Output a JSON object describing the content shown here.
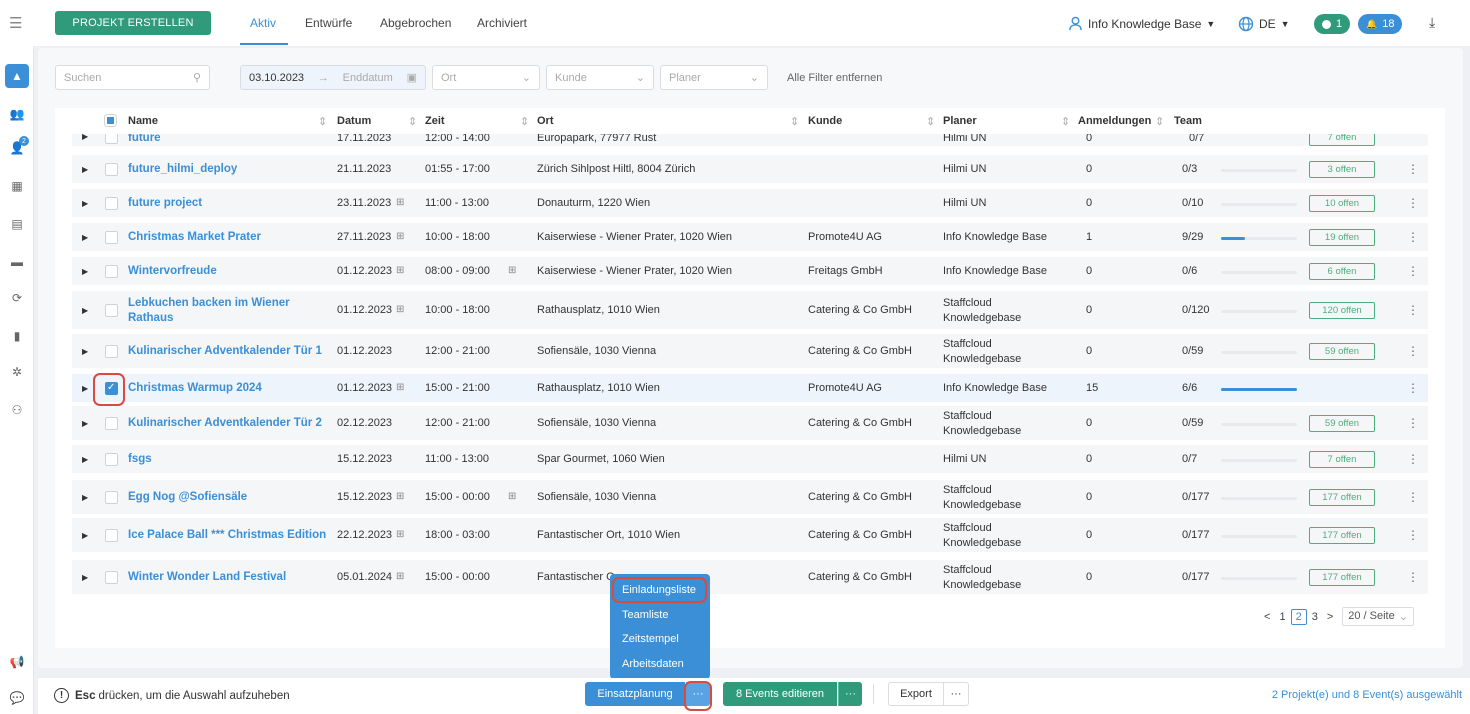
{
  "colors": {
    "accent": "#3a8fd6",
    "green": "#2f9b7a",
    "highlight": "#d94a3f"
  },
  "topbar": {
    "create_button": "PROJEKT ERSTELLEN",
    "tabs": [
      {
        "label": "Aktiv"
      },
      {
        "label": "Entwürfe"
      },
      {
        "label": "Abgebrochen"
      },
      {
        "label": "Archiviert"
      }
    ],
    "user": "Info Knowledge Base",
    "language": "DE",
    "chat_count": "1",
    "notification_count": "18"
  },
  "filters": {
    "search_placeholder": "Suchen",
    "start_date": "03.10.2023",
    "end_date_placeholder": "Enddatum",
    "location_placeholder": "Ort",
    "customer_placeholder": "Kunde",
    "planner_placeholder": "Planer",
    "clear_filters": "Alle Filter entfernen"
  },
  "table": {
    "headers": {
      "name": "Name",
      "date": "Datum",
      "time": "Zeit",
      "location": "Ort",
      "customer": "Kunde",
      "planner": "Planer",
      "registrations": "Anmeldungen",
      "team": "Team"
    },
    "partial_row": {
      "name": "future",
      "date": "17.11.2023",
      "time": "12:00 - 14:00",
      "location": "Europapark, 77977 Rust",
      "planner": "Hilmi UN",
      "registrations": "0",
      "team": "0/7",
      "open": "7 offen"
    },
    "rows": [
      {
        "name": "future_hilmi_deploy",
        "date": "21.11.2023",
        "time": "01:55 - 17:00",
        "location": "Zürich Sihlpost Hiltl, 8004 Zürich",
        "customer": "",
        "planner": "Hilmi UN",
        "registrations": "0",
        "team": "0/3",
        "progress": 0,
        "open": "3 offen"
      },
      {
        "name": "future project",
        "date": "23.11.2023",
        "time": "11:00 - 13:00",
        "location": "Donauturm, 1220 Wien",
        "customer": "",
        "planner": "Hilmi UN",
        "registrations": "0",
        "team": "0/10",
        "progress": 0,
        "open": "10 offen"
      },
      {
        "name": "Christmas Market Prater",
        "date": "27.11.2023",
        "time": "10:00 - 18:00",
        "location": "Kaiserwiese - Wiener Prater, 1020 Wien",
        "customer": "Promote4U AG",
        "planner": "Info Knowledge Base",
        "registrations": "1",
        "team": "9/29",
        "progress": 0.31,
        "open": "19 offen"
      },
      {
        "name": "Wintervorfreude",
        "date": "01.12.2023",
        "time": "08:00 - 09:00",
        "location": "Kaiserwiese - Wiener Prater, 1020 Wien",
        "customer": "Freitags GmbH",
        "planner": "Info Knowledge Base",
        "registrations": "0",
        "team": "0/6",
        "progress": 0,
        "open": "6 offen"
      },
      {
        "name_line1": "Lebkuchen backen im Wiener",
        "name_line2": "Rathaus",
        "date": "01.12.2023",
        "time": "10:00 - 18:00",
        "location": "Rathausplatz, 1010 Wien",
        "customer": "Catering & Co GmbH",
        "planner_line1": "Staffcloud",
        "planner_line2": "Knowledgebase",
        "registrations": "0",
        "team": "0/120",
        "progress": 0,
        "open": "120 offen"
      },
      {
        "name": "Kulinarischer Adventkalender Tür 1",
        "date": "01.12.2023",
        "time": "12:00 - 21:00",
        "location": "Sofiensäle, 1030 Vienna",
        "customer": "Catering & Co GmbH",
        "planner_line1": "Staffcloud",
        "planner_line2": "Knowledgebase",
        "registrations": "0",
        "team": "0/59",
        "progress": 0,
        "open": "59 offen"
      },
      {
        "name": "Christmas Warmup 2024",
        "date": "01.12.2023",
        "time": "15:00 - 21:00",
        "location": "Rathausplatz, 1010 Wien",
        "customer": "Promote4U AG",
        "planner": "Info Knowledge Base",
        "registrations": "15",
        "team": "6/6",
        "progress": 1,
        "open": ""
      },
      {
        "name": "Kulinarischer Adventkalender Tür 2",
        "date": "02.12.2023",
        "time": "12:00 - 21:00",
        "location": "Sofiensäle, 1030 Vienna",
        "customer": "Catering & Co GmbH",
        "planner_line1": "Staffcloud",
        "planner_line2": "Knowledgebase",
        "registrations": "0",
        "team": "0/59",
        "progress": 0,
        "open": "59 offen"
      },
      {
        "name": "fsgs",
        "date": "15.12.2023",
        "time": "11:00 - 13:00",
        "location": "Spar Gourmet, 1060 Wien",
        "customer": "",
        "planner": "Hilmi UN",
        "registrations": "0",
        "team": "0/7",
        "progress": 0,
        "open": "7 offen"
      },
      {
        "name": "Egg Nog @Sofiensäle",
        "date": "15.12.2023",
        "time": "15:00 - 00:00",
        "location": "Sofiensäle, 1030 Vienna",
        "customer": "Catering & Co GmbH",
        "planner_line1": "Staffcloud",
        "planner_line2": "Knowledgebase",
        "registrations": "0",
        "team": "0/177",
        "progress": 0,
        "open": "177 offen"
      },
      {
        "name": "Ice Palace Ball *** Christmas Edition",
        "date": "22.12.2023",
        "time": "18:00 - 03:00",
        "location": "Fantastischer Ort, 1010 Wien",
        "customer": "Catering & Co GmbH",
        "planner_line1": "Staffcloud",
        "planner_line2": "Knowledgebase",
        "registrations": "0",
        "team": "0/177",
        "progress": 0,
        "open": "177 offen"
      },
      {
        "name": "Winter Wonder Land Festival",
        "date": "05.01.2024",
        "time": "15:00 - 00:00",
        "location": "Fantastischer O",
        "customer": "Catering & Co GmbH",
        "planner_line1": "Staffcloud",
        "planner_line2": "Knowledgebase",
        "registrations": "0",
        "team": "0/177",
        "progress": 0,
        "open": "177 offen"
      }
    ]
  },
  "pagination": {
    "prev": "<",
    "p1": "1",
    "p2": "2",
    "p3": "3",
    "next": ">",
    "page_size": "20 / Seite"
  },
  "dropdown_menu": [
    "Einladungsliste",
    "Teamliste",
    "Zeitstempel",
    "Arbeitsdaten"
  ],
  "bottombar": {
    "hint_key": "Esc",
    "hint_text": "drücken, um die Auswahl aufzuheben",
    "einsatzplanung": "Einsatzplanung",
    "edit_events": "8 Events editieren",
    "export": "Export",
    "more": "···",
    "selection_status": "2 Projekt(e) und 8 Event(s) ausgewählt"
  }
}
